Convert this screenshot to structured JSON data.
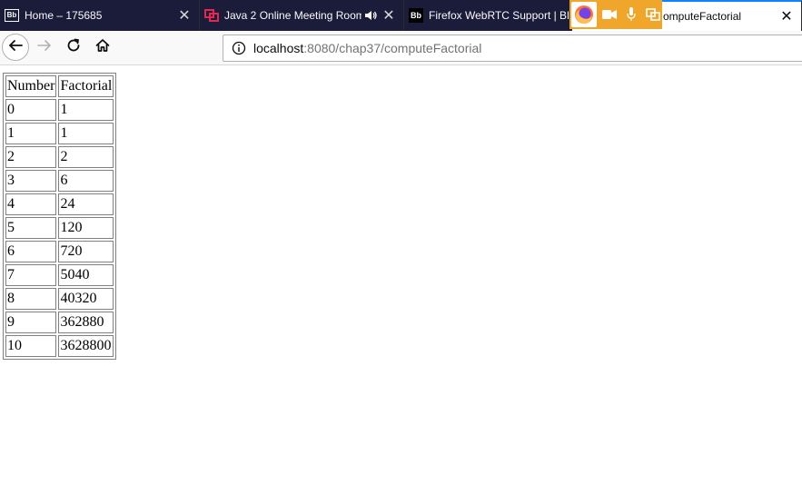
{
  "browser": {
    "tabs": [
      {
        "label": "Home – 175685",
        "favicon": "blackboard-logo-icon"
      },
      {
        "label": "Java 2 Online Meeting Room",
        "favicon": "collaborate-icon",
        "audio": "speaker-icon"
      },
      {
        "label": "Firefox WebRTC Support | Bla",
        "favicon": "blackboard-logo-icon"
      },
      {
        "label": "omputeFactorial",
        "favicon": ""
      }
    ],
    "close_glyph": "✕",
    "share_indicator": {
      "icons": [
        "firefox-icon",
        "camera-icon",
        "microphone-icon",
        "screen-share-icon"
      ],
      "color": "#f0a52b"
    },
    "url": {
      "host": "localhost",
      "rest": ":8080/chap37/computeFactorial"
    }
  },
  "page": {
    "table": {
      "headers": [
        "Number",
        "Factorial"
      ],
      "rows": [
        [
          "0",
          "1"
        ],
        [
          "1",
          "1"
        ],
        [
          "2",
          "2"
        ],
        [
          "3",
          "6"
        ],
        [
          "4",
          "24"
        ],
        [
          "5",
          "120"
        ],
        [
          "6",
          "720"
        ],
        [
          "7",
          "5040"
        ],
        [
          "8",
          "40320"
        ],
        [
          "9",
          "362880"
        ],
        [
          "10",
          "3628800"
        ]
      ]
    }
  }
}
